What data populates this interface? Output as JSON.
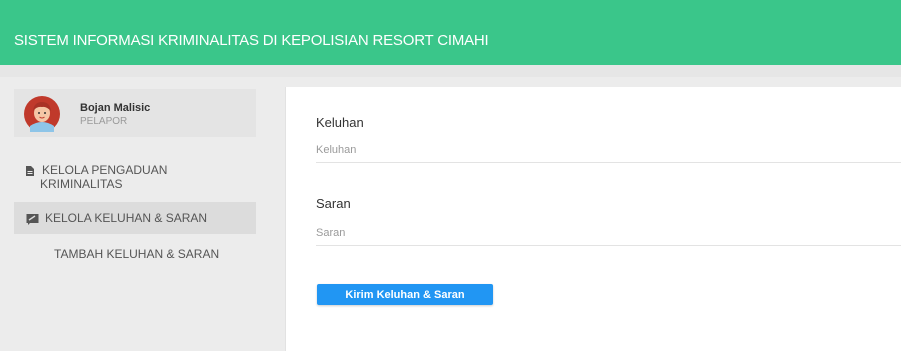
{
  "header": {
    "title": "SISTEM INFORMASI KRIMINALITAS DI KEPOLISIAN RESORT CIMAHI"
  },
  "user": {
    "name": "Bojan Malisic",
    "role": "PELAPOR",
    "avatar_icon": "female-avatar-icon"
  },
  "sidebar": {
    "items": [
      {
        "label": "KELOLA PENGADUAN KRIMINALITAS",
        "icon": "document-icon"
      },
      {
        "label": "KELOLA KELUHAN & SARAN",
        "icon": "comment-icon",
        "active": true
      },
      {
        "label": "TAMBAH KELUHAN & SARAN",
        "icon": ""
      }
    ]
  },
  "form": {
    "keluhan_label": "Keluhan",
    "keluhan_placeholder": "Keluhan",
    "saran_label": "Saran",
    "saran_placeholder": "Saran",
    "submit_label": "Kirim Keluhan & Saran"
  },
  "colors": {
    "header": "#3ac68a",
    "button": "#2196f3"
  }
}
